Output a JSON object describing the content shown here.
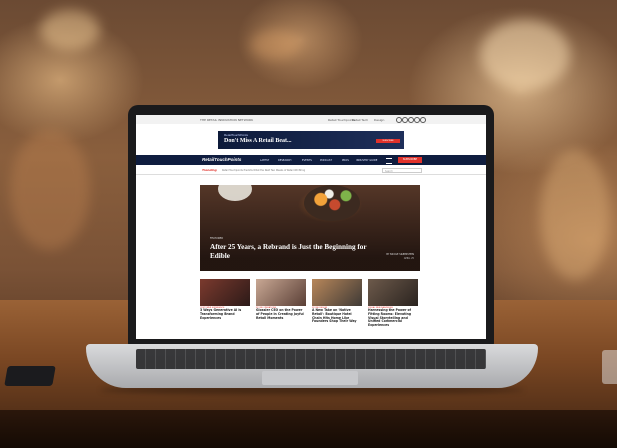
{
  "scene": {
    "bokeh_colors": [
      "#ffd9a0",
      "#ffe3b8",
      "#f0b070",
      "#ffcf90"
    ]
  },
  "website": {
    "top_strip": {
      "left_text": "THE RETAIL INNOVATION NETWORK",
      "right_a": "Retail Touchpoints",
      "right_b": "Retail Tech",
      "right_c": "Design"
    },
    "ad": {
      "brand": "RetailTouchPoints",
      "headline": "Don't Miss A Retail Beat...",
      "button": "SUBSCRIBE"
    },
    "nav": {
      "logo": "RetailTouchPoints",
      "items": [
        "LATEST",
        "RESEARCH",
        "EVENTS",
        "PODCAST",
        "PROS",
        "INDUSTRY GUIDE"
      ],
      "subscribe": "SUBSCRIBE"
    },
    "trending": {
      "label": "Trending",
      "text": "Retail Touchpoints Predicts What the Next Two Weeks of Retail Will Bring",
      "search_placeholder": "Search"
    },
    "hero": {
      "tag": "FEATURED",
      "title": "After 25 Years, a Rebrand is Just the Beginning for Edible",
      "byline": "BY NICOLE SILBERSTEIN",
      "date": "APRIL 25"
    },
    "cards": [
      {
        "category": "CUSTOMER EXPERIENCE",
        "title": "3 Ways Generative AI is Transforming Brand Experiences"
      },
      {
        "category": "STORE OPERATIONS",
        "title": "Glossier CEO on the Power of People in Creating Joyful Retail Moments"
      },
      {
        "category": "STORE DESIGN",
        "title": "A New Take on 'Native Retail': Boutique Hotel Chain Hits Home Like Founders Shop Their Way"
      },
      {
        "category": "VISUAL MERCHANDISING",
        "title": "Harnessing the Power of Fitting Rooms: Elevating Visual Storytelling and Unified Commercial Experiences"
      }
    ]
  }
}
